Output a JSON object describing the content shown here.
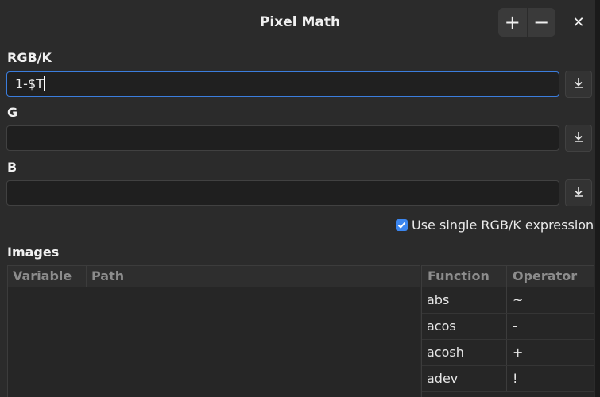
{
  "window": {
    "title": "Pixel Math",
    "add_button": "+",
    "remove_button": "−",
    "close_button": "✕"
  },
  "fields": {
    "rgbk": {
      "label": "RGB/K",
      "value": "1-$T"
    },
    "g": {
      "label": "G",
      "value": ""
    },
    "b": {
      "label": "B",
      "value": ""
    }
  },
  "options": {
    "single_expression_label": "Use single RGB/K expression",
    "single_expression_checked": true
  },
  "images": {
    "label": "Images",
    "columns": [
      "Variable",
      "Path"
    ]
  },
  "functions": {
    "columns": [
      "Function",
      "Operator"
    ],
    "rows": [
      {
        "function": "abs",
        "operator": "~"
      },
      {
        "function": "acos",
        "operator": "-"
      },
      {
        "function": "acosh",
        "operator": "+"
      },
      {
        "function": "adev",
        "operator": "!"
      }
    ]
  },
  "colors": {
    "accent": "#3b86f0",
    "window_bg": "#2b2b2b",
    "field_bg": "#1f1f1f"
  }
}
